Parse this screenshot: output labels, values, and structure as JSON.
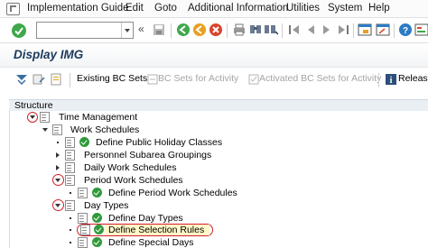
{
  "menubar": {
    "items": [
      {
        "label": "Implementation Guide"
      },
      {
        "label": "Edit"
      },
      {
        "label": "Goto"
      },
      {
        "label": "Additional Information"
      },
      {
        "label": "Utilities"
      },
      {
        "label": "System"
      },
      {
        "label": "Help"
      }
    ]
  },
  "toolbar": {
    "command_field_value": "",
    "double_chevron": "«"
  },
  "title": "Display IMG",
  "app_toolbar": {
    "existing_bc_sets": "Existing BC Sets",
    "bc_sets_for_activity": "BC Sets for Activity",
    "activated_bc_sets": "Activated BC Sets for Activity",
    "release": "Release"
  },
  "tree": {
    "header": "Structure",
    "rows": [
      {
        "label": "Time Management"
      },
      {
        "label": "Work Schedules"
      },
      {
        "label": "Define Public Holiday Classes"
      },
      {
        "label": "Personnel Subarea Groupings"
      },
      {
        "label": "Daily Work Schedules"
      },
      {
        "label": "Period Work Schedules"
      },
      {
        "label": "Define Period Work Schedules"
      },
      {
        "label": "Day Types"
      },
      {
        "label": "Define Day Types"
      },
      {
        "label": "Define Selection Rules"
      },
      {
        "label": "Define Special Days"
      }
    ]
  },
  "colors": {
    "title_text": "#1b3a5c",
    "highlight_ring": "#d0202a",
    "execute_green": "#2f9a3a"
  }
}
